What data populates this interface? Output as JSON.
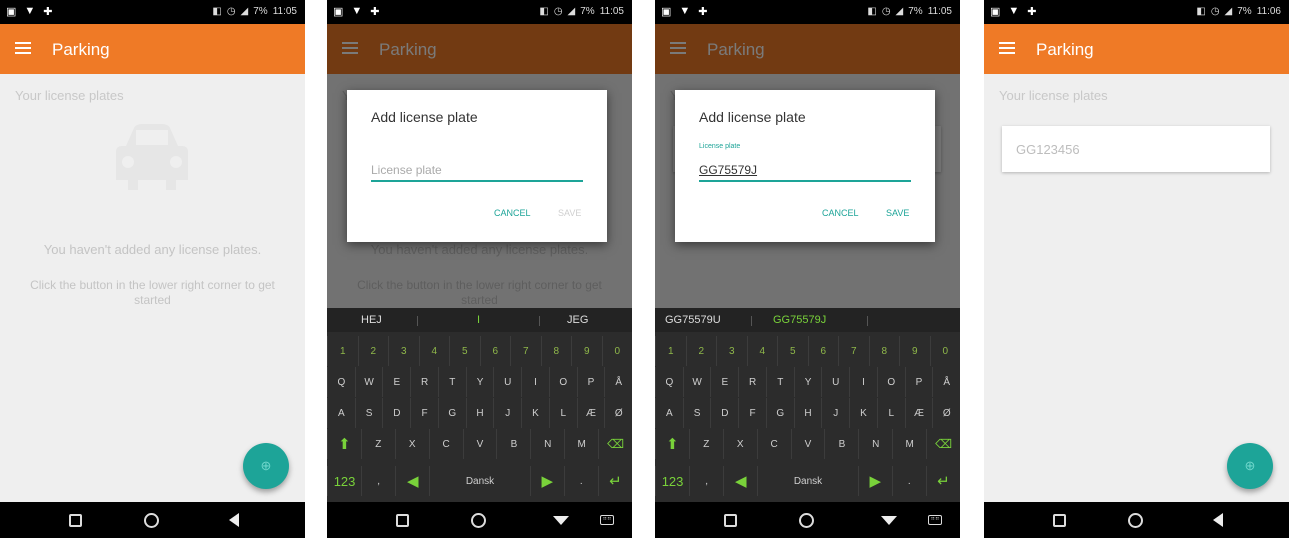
{
  "status": {
    "time_a": "11:05",
    "time_b": "11:06",
    "battery": "7%"
  },
  "app": {
    "title": "Parking",
    "accent": "#ef7a26",
    "teal": "#1da498"
  },
  "list": {
    "section_label": "Your license plates",
    "empty_title": "You haven't added any license plates.",
    "empty_hint": "Click the button in the lower right corner to get started",
    "plates": [
      "GG123456"
    ]
  },
  "dialog": {
    "title": "Add license plate",
    "placeholder": "License plate",
    "floating_label": "License plate",
    "typed_value": "GG75579J",
    "cancel_label": "CANCEL",
    "save_label": "SAVE"
  },
  "keyboard": {
    "suggestions_a": [
      "HEJ",
      "I",
      "JEG"
    ],
    "suggestions_b": [
      "GG75579U",
      "GG75579J"
    ],
    "numbers": [
      "1",
      "2",
      "3",
      "4",
      "5",
      "6",
      "7",
      "8",
      "9",
      "0"
    ],
    "row_q": [
      "Q",
      "W",
      "E",
      "R",
      "T",
      "Y",
      "U",
      "I",
      "O",
      "P",
      "Å"
    ],
    "row_a": [
      "A",
      "S",
      "D",
      "F",
      "G",
      "H",
      "J",
      "K",
      "L",
      "Æ",
      "Ø"
    ],
    "row_z": [
      "Z",
      "X",
      "C",
      "V",
      "B",
      "N",
      "M"
    ],
    "mode_label": "123",
    "comma": ",",
    "language": "Dansk"
  }
}
